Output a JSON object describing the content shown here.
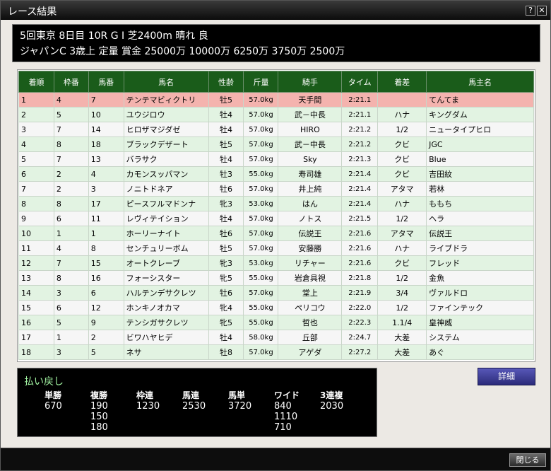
{
  "window": {
    "title": "レース結果",
    "help_label": "?",
    "close_label": "✕"
  },
  "race": {
    "line1": "5回東京  8日目  10R  G I  芝2400m  晴れ  良",
    "line2": "ジャパンC  3歳上  定量  賞金  25000万  10000万  6250万  3750万  2500万"
  },
  "table": {
    "headers": [
      "着順",
      "枠番",
      "馬番",
      "馬名",
      "性齢",
      "斤量",
      "騎手",
      "タイム",
      "着差",
      "馬主名"
    ],
    "rows": [
      {
        "rank": "1",
        "waku": "4",
        "umaban": "7",
        "name": "テンテマビィクトリ",
        "sexage": "牡5",
        "weight": "57.0kg",
        "jockey": "天手間",
        "time": "2:21.1",
        "margin": "",
        "owner": "てんてま"
      },
      {
        "rank": "2",
        "waku": "5",
        "umaban": "10",
        "name": "ユウジロウ",
        "sexage": "牡4",
        "weight": "57.0kg",
        "jockey": "武－中長",
        "time": "2:21.1",
        "margin": "ハナ",
        "owner": "キングダム"
      },
      {
        "rank": "3",
        "waku": "7",
        "umaban": "14",
        "name": "ヒロザマジダゼ",
        "sexage": "牡4",
        "weight": "57.0kg",
        "jockey": "HIRO",
        "time": "2:21.2",
        "margin": "1/2",
        "owner": "ニュータイプヒロ"
      },
      {
        "rank": "4",
        "waku": "8",
        "umaban": "18",
        "name": "ブラックデザート",
        "sexage": "牡5",
        "weight": "57.0kg",
        "jockey": "武－中長",
        "time": "2:21.2",
        "margin": "クビ",
        "owner": "JGC"
      },
      {
        "rank": "5",
        "waku": "7",
        "umaban": "13",
        "name": "バラサク",
        "sexage": "牡4",
        "weight": "57.0kg",
        "jockey": "Sky",
        "time": "2:21.3",
        "margin": "クビ",
        "owner": "Blue"
      },
      {
        "rank": "6",
        "waku": "2",
        "umaban": "4",
        "name": "カモンスッパマン",
        "sexage": "牡3",
        "weight": "55.0kg",
        "jockey": "寿司雄",
        "time": "2:21.4",
        "margin": "クビ",
        "owner": "吉田紋"
      },
      {
        "rank": "7",
        "waku": "2",
        "umaban": "3",
        "name": "ノニトドネア",
        "sexage": "牡6",
        "weight": "57.0kg",
        "jockey": "井上純",
        "time": "2:21.4",
        "margin": "アタマ",
        "owner": "若林"
      },
      {
        "rank": "8",
        "waku": "8",
        "umaban": "17",
        "name": "ピースフルマドンナ",
        "sexage": "牝3",
        "weight": "53.0kg",
        "jockey": "はん",
        "time": "2:21.4",
        "margin": "ハナ",
        "owner": "ももち"
      },
      {
        "rank": "9",
        "waku": "6",
        "umaban": "11",
        "name": "レヴィテイション",
        "sexage": "牡4",
        "weight": "57.0kg",
        "jockey": "ノトス",
        "time": "2:21.5",
        "margin": "1/2",
        "owner": "ヘラ"
      },
      {
        "rank": "10",
        "waku": "1",
        "umaban": "1",
        "name": "ホーリーナイト",
        "sexage": "牡6",
        "weight": "57.0kg",
        "jockey": "伝説王",
        "time": "2:21.6",
        "margin": "アタマ",
        "owner": "伝説王"
      },
      {
        "rank": "11",
        "waku": "4",
        "umaban": "8",
        "name": "センチュリーボム",
        "sexage": "牡5",
        "weight": "57.0kg",
        "jockey": "安藤勝",
        "time": "2:21.6",
        "margin": "ハナ",
        "owner": "ライブドラ"
      },
      {
        "rank": "12",
        "waku": "7",
        "umaban": "15",
        "name": "オートクレーブ",
        "sexage": "牝3",
        "weight": "53.0kg",
        "jockey": "リチャー",
        "time": "2:21.6",
        "margin": "クビ",
        "owner": "フレッド"
      },
      {
        "rank": "13",
        "waku": "8",
        "umaban": "16",
        "name": "フォーシスター",
        "sexage": "牝5",
        "weight": "55.0kg",
        "jockey": "岩倉具視",
        "time": "2:21.8",
        "margin": "1/2",
        "owner": "金魚"
      },
      {
        "rank": "14",
        "waku": "3",
        "umaban": "6",
        "name": "ハルテンデサクレツ",
        "sexage": "牡6",
        "weight": "57.0kg",
        "jockey": "堂上",
        "time": "2:21.9",
        "margin": "3/4",
        "owner": "ヴァルドロ"
      },
      {
        "rank": "15",
        "waku": "6",
        "umaban": "12",
        "name": "ホンキノオカマ",
        "sexage": "牝4",
        "weight": "55.0kg",
        "jockey": "ペリコウ",
        "time": "2:22.0",
        "margin": "1/2",
        "owner": "ファインテック"
      },
      {
        "rank": "16",
        "waku": "5",
        "umaban": "9",
        "name": "テンシガサクレツ",
        "sexage": "牝5",
        "weight": "55.0kg",
        "jockey": "哲也",
        "time": "2:22.3",
        "margin": "1.1/4",
        "owner": "皇神威"
      },
      {
        "rank": "17",
        "waku": "1",
        "umaban": "2",
        "name": "ビワハヤヒデ",
        "sexage": "牡4",
        "weight": "58.0kg",
        "jockey": "丘部",
        "time": "2:24.7",
        "margin": "大差",
        "owner": "システム"
      },
      {
        "rank": "18",
        "waku": "3",
        "umaban": "5",
        "name": "ネサ",
        "sexage": "牡8",
        "weight": "57.0kg",
        "jockey": "アゲダ",
        "time": "2:27.2",
        "margin": "大差",
        "owner": "あぐ"
      }
    ]
  },
  "payout": {
    "title": "払い戻し",
    "columns": [
      {
        "label": "単勝",
        "values": [
          "670"
        ]
      },
      {
        "label": "複勝",
        "values": [
          "190",
          "150",
          "180"
        ]
      },
      {
        "label": "枠連",
        "values": [
          "1230"
        ]
      },
      {
        "label": "馬連",
        "values": [
          "2530"
        ]
      },
      {
        "label": "馬単",
        "values": [
          "3720"
        ]
      },
      {
        "label": "ワイド",
        "values": [
          "840",
          "1110",
          "710"
        ]
      },
      {
        "label": "3連複",
        "values": [
          "2030"
        ]
      }
    ]
  },
  "buttons": {
    "detail": "詳細",
    "close": "閉じる"
  }
}
